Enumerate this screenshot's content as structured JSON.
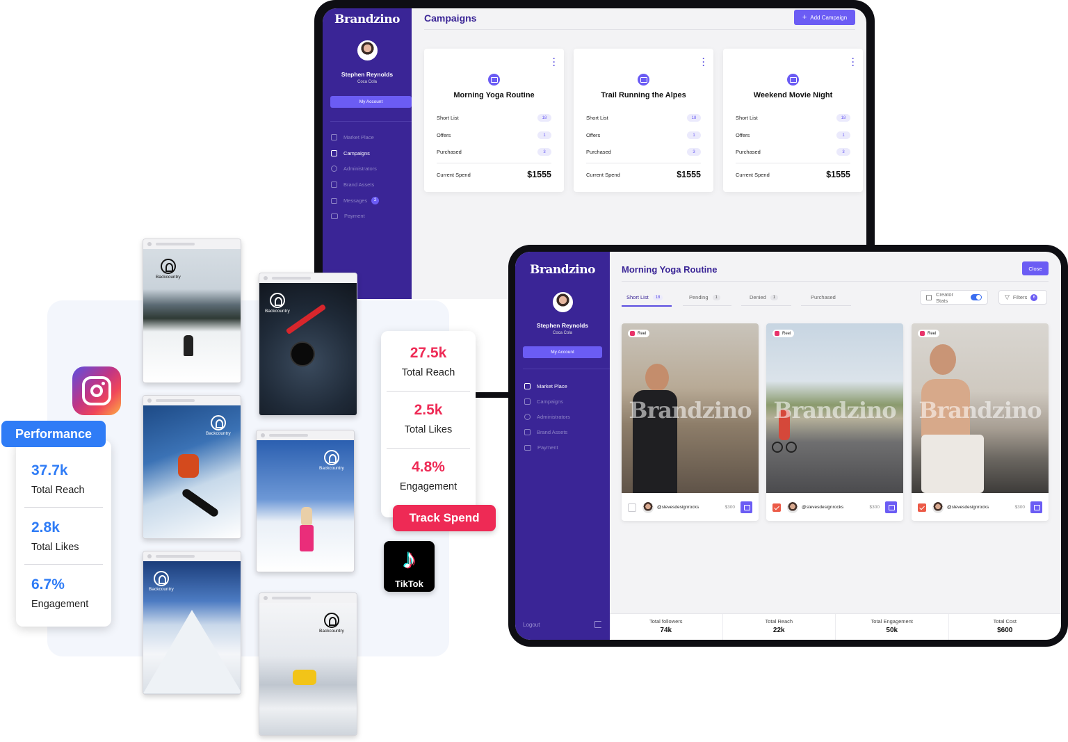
{
  "campaigns_screen": {
    "brand": "Brandzino",
    "user_name": "Stephen Reynolds",
    "user_company": "Coca Cola",
    "account_button": "My Account",
    "nav": [
      {
        "label": "Market Place",
        "icon": "home-icon",
        "active": false
      },
      {
        "label": "Campaigns",
        "icon": "folder-icon",
        "active": true
      },
      {
        "label": "Administrators",
        "icon": "users-icon",
        "active": false
      },
      {
        "label": "Brand Assets",
        "icon": "box-icon",
        "active": false
      },
      {
        "label": "Messages",
        "icon": "chat-icon",
        "active": false,
        "badge": "2"
      },
      {
        "label": "Payment",
        "icon": "card-icon",
        "active": false
      }
    ],
    "title": "Campaigns",
    "add_button": "Add Campaign",
    "cards": [
      {
        "title": "Morning Yoga Routine",
        "rows": [
          {
            "label": "Short List",
            "value": "18"
          },
          {
            "label": "Offers",
            "value": "1"
          },
          {
            "label": "Purchased",
            "value": "3"
          }
        ],
        "spend_label": "Current Spend",
        "spend": "$1555"
      },
      {
        "title": "Trail Running the Alpes",
        "rows": [
          {
            "label": "Short List",
            "value": "18"
          },
          {
            "label": "Offers",
            "value": "1"
          },
          {
            "label": "Purchased",
            "value": "3"
          }
        ],
        "spend_label": "Current Spend",
        "spend": "$1555"
      },
      {
        "title": "Weekend Movie Night",
        "rows": [
          {
            "label": "Short List",
            "value": "18"
          },
          {
            "label": "Offers",
            "value": "1"
          },
          {
            "label": "Purchased",
            "value": "3"
          }
        ],
        "spend_label": "Current Spend",
        "spend": "$1555"
      }
    ]
  },
  "campaign_detail": {
    "brand": "Brandzino",
    "user_name": "Stephen Reynolds",
    "user_company": "Coca Cola",
    "account_button": "My Account",
    "nav": [
      {
        "label": "Market Place",
        "icon": "home-icon",
        "active": true
      },
      {
        "label": "Campaigns",
        "icon": "folder-icon",
        "active": false
      },
      {
        "label": "Administrators",
        "icon": "users-icon",
        "active": false
      },
      {
        "label": "Brand Assets",
        "icon": "box-icon",
        "active": false
      },
      {
        "label": "Payment",
        "icon": "card-icon",
        "active": false
      }
    ],
    "logout": "Logout",
    "title": "Morning Yoga Routine",
    "close_button": "Close",
    "tabs": [
      {
        "label": "Short List",
        "count": "18",
        "active": true
      },
      {
        "label": "Pending",
        "count": "1",
        "active": false
      },
      {
        "label": "Denied",
        "count": "1",
        "active": false
      },
      {
        "label": "Purchased",
        "count": "",
        "active": false
      }
    ],
    "creator_stats": "Creator Stats",
    "filters": "Filters",
    "filters_count": "6",
    "posts": [
      {
        "tag": "Reel",
        "watermark": "Brandzino",
        "handle": "@stevesdesignrocks",
        "price": "$300",
        "checked": false
      },
      {
        "tag": "Reel",
        "watermark": "Brandzino",
        "handle": "@stevesdesignrocks",
        "price": "$300",
        "checked": true
      },
      {
        "tag": "Reel",
        "watermark": "Brandzino",
        "handle": "@stevesdesignrocks",
        "price": "$300",
        "checked": true
      }
    ],
    "totals": [
      {
        "label": "Total followers",
        "value": "74k"
      },
      {
        "label": "Total Reach",
        "value": "22k"
      },
      {
        "label": "Total Engagement",
        "value": "50k"
      },
      {
        "label": "Total Cost",
        "value": "$600"
      }
    ]
  },
  "instagram": {
    "badge": "Performance",
    "stats": [
      {
        "value": "37.7k",
        "label": "Total Reach"
      },
      {
        "value": "2.8k",
        "label": "Total Likes"
      },
      {
        "value": "6.7%",
        "label": "Engagement"
      }
    ]
  },
  "tiktok": {
    "logo_text": "TikTok",
    "stats": [
      {
        "value": "27.5k",
        "label": "Total Reach"
      },
      {
        "value": "2.5k",
        "label": "Total Likes"
      },
      {
        "value": "4.8%",
        "label": "Engagement"
      }
    ],
    "button": "Track Spend"
  },
  "phone_posts": [
    {
      "brand": "Backcountry"
    },
    {
      "brand": "Backcountry"
    },
    {
      "brand": "Backcountry"
    },
    {
      "brand": "Backcountry"
    },
    {
      "brand": "Backcountry"
    },
    {
      "brand": "Backcountry"
    }
  ],
  "colors": {
    "primary": "#3a2596",
    "accent": "#6b5cf4",
    "instagram_blue": "#2f7cf6",
    "tiktok_red": "#ee2a55"
  }
}
